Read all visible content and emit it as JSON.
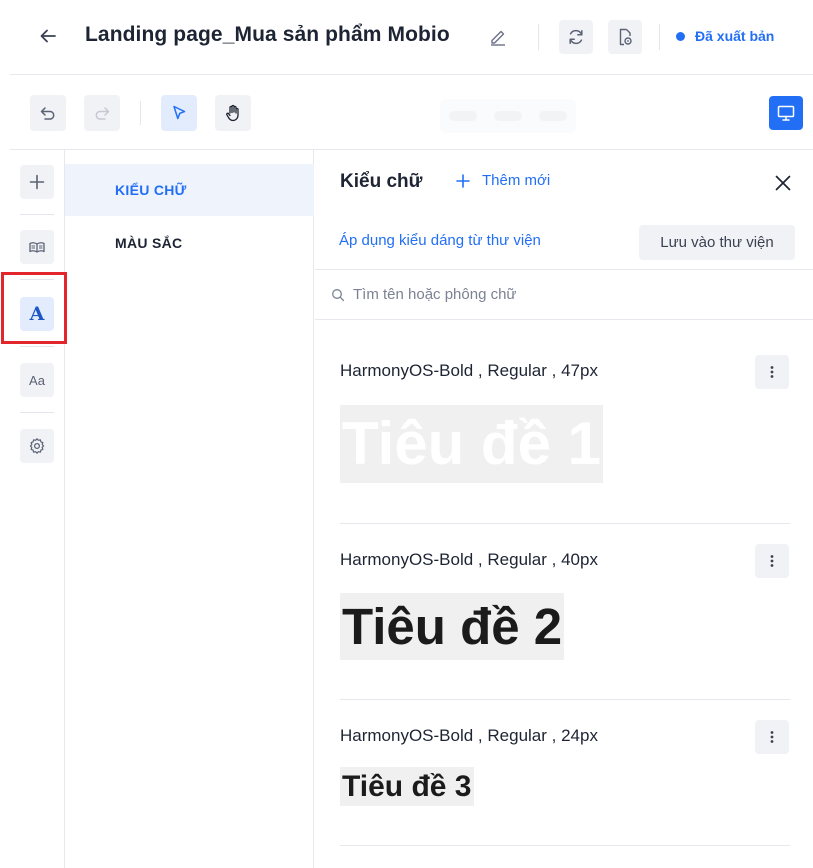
{
  "header": {
    "title": "Landing page_Mua sản phẩm Mobio",
    "status": "Đã xuất bản",
    "status_color": "#226ff5",
    "icons": [
      "arrow-left-icon",
      "pencil-icon",
      "refresh-icon",
      "document-preview-icon"
    ]
  },
  "toolbar": {
    "icons": [
      "undo-icon",
      "redo-icon",
      "cursor-pointer-icon",
      "hand-pan-icon",
      "desktop-monitor-icon"
    ],
    "active_tool": "select"
  },
  "rail": {
    "items": [
      {
        "icon": "plus-icon"
      },
      {
        "icon": "book-open-icon"
      },
      {
        "label": "A",
        "icon": "typography-icon",
        "active": true
      },
      {
        "label": "Aa",
        "icon": "text-size-icon"
      },
      {
        "icon": "gear-icon"
      }
    ]
  },
  "categories": [
    {
      "label": "KIỂU CHỮ",
      "active": true
    },
    {
      "label": "MÀU SẮC",
      "active": false
    }
  ],
  "panel": {
    "title": "Kiểu chữ",
    "add_new": "Thêm mới",
    "apply_link": "Áp dụng kiểu dáng từ thư viện",
    "save_library": "Lưu vào thư viện",
    "search_placeholder": "Tìm tên hoặc phông chữ"
  },
  "styles": [
    {
      "meta": "HarmonyOS-Bold , Regular , 47px",
      "preview": "Tiêu đề 1",
      "preview_color": "#ffffff"
    },
    {
      "meta": "HarmonyOS-Bold , Regular , 40px",
      "preview": "Tiêu đề 2",
      "preview_color": "#1b1b1b"
    },
    {
      "meta": "HarmonyOS-Bold , Regular , 24px",
      "preview": "Tiêu đề 3",
      "preview_color": "#1b1b1b"
    }
  ],
  "colors": {
    "accent": "#226ff5",
    "highlight_frame": "#e2262b"
  }
}
